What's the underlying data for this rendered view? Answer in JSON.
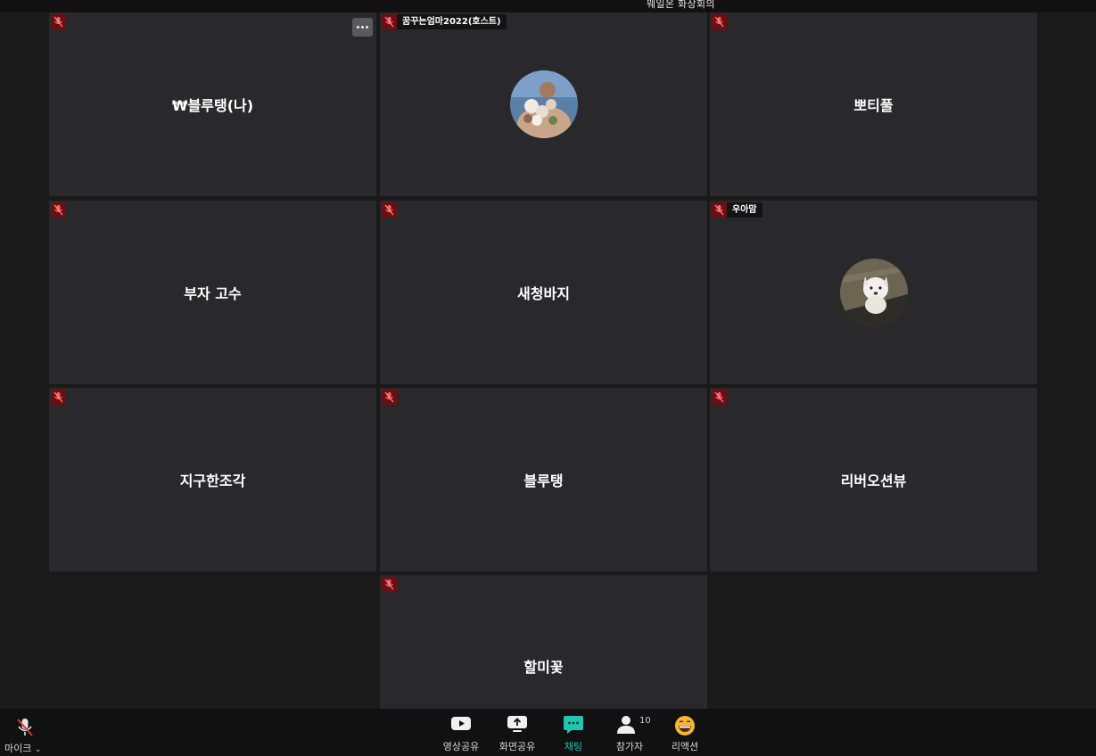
{
  "meeting": {
    "title": "웨일온 화상회의"
  },
  "participants": [
    {
      "name": "₩블루탱(나)",
      "has_avatar": false,
      "is_me": true
    },
    {
      "name": "꿈꾸는엄마2022(호스트)",
      "has_avatar": true,
      "tag": "꿈꾸는엄마2022(호스트)",
      "avatar": "flowers-photo"
    },
    {
      "name": "뽀티풀",
      "has_avatar": false
    },
    {
      "name": "부자 고수",
      "has_avatar": false
    },
    {
      "name": "새청바지",
      "has_avatar": false
    },
    {
      "name": "우아맘",
      "has_avatar": true,
      "tag": "우아맘",
      "avatar": "dog-photo"
    },
    {
      "name": "지구한조각",
      "has_avatar": false
    },
    {
      "name": "블루탱",
      "has_avatar": false
    },
    {
      "name": "리버오션뷰",
      "has_avatar": false
    },
    {
      "name": "할미꽃",
      "has_avatar": false
    }
  ],
  "toolbar": {
    "mic_label": "마이크",
    "video_share_label": "영상공유",
    "screen_share_label": "화면공유",
    "chat_label": "채팅",
    "participants_label": "참가자",
    "participants_count": "10",
    "reaction_label": "리액션"
  },
  "colors": {
    "tile_bg": "#29292c",
    "mute_badge": "#6b0f12",
    "chat_active": "#22c3b0",
    "bar_bg": "#111111"
  }
}
